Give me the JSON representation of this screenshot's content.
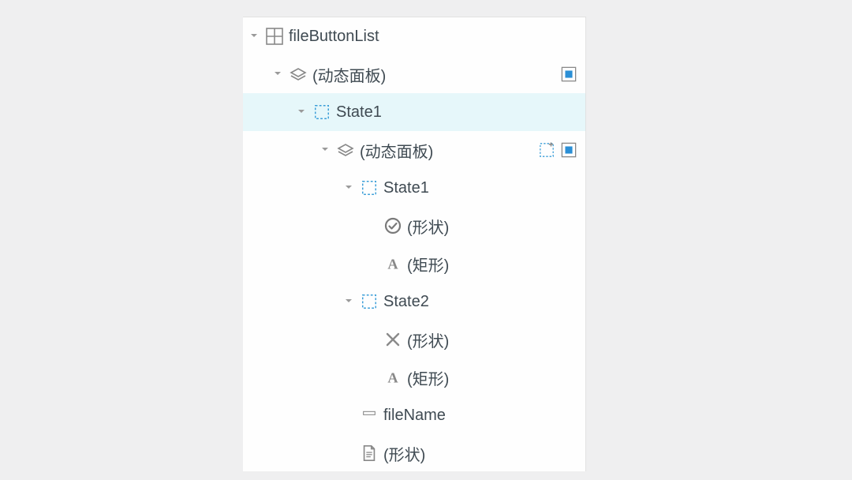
{
  "tree": [
    {
      "indent": 0,
      "chevron": true,
      "icon": "grid",
      "label": "fileButtonList",
      "badges": [],
      "selected": false
    },
    {
      "indent": 1,
      "chevron": true,
      "icon": "dynpanel",
      "label": "(动态面板)",
      "badges": [
        "square-blue"
      ],
      "selected": false
    },
    {
      "indent": 2,
      "chevron": true,
      "icon": "dashed-rect",
      "label": "State1",
      "badges": [],
      "selected": true
    },
    {
      "indent": 3,
      "chevron": true,
      "icon": "dynpanel",
      "label": "(动态面板)",
      "badges": [
        "dashed-plus",
        "square-blue"
      ],
      "selected": false
    },
    {
      "indent": 4,
      "chevron": true,
      "icon": "dashed-rect",
      "label": "State1",
      "badges": [],
      "selected": false
    },
    {
      "indent": 5,
      "chevron": false,
      "icon": "check-circle",
      "label": "(形状)",
      "badges": [],
      "selected": false
    },
    {
      "indent": 5,
      "chevron": false,
      "icon": "text-A",
      "label": "(矩形)",
      "badges": [],
      "selected": false
    },
    {
      "indent": 4,
      "chevron": true,
      "icon": "dashed-rect",
      "label": "State2",
      "badges": [],
      "selected": false
    },
    {
      "indent": 5,
      "chevron": false,
      "icon": "cross",
      "label": "(形状)",
      "badges": [],
      "selected": false
    },
    {
      "indent": 5,
      "chevron": false,
      "icon": "text-A",
      "label": "(矩形)",
      "badges": [],
      "selected": false
    },
    {
      "indent": 4,
      "chevron": false,
      "icon": "bar",
      "label": "fileName",
      "badges": [],
      "selected": false
    },
    {
      "indent": 4,
      "chevron": false,
      "icon": "page",
      "label": "(形状)",
      "badges": [],
      "selected": false
    }
  ]
}
